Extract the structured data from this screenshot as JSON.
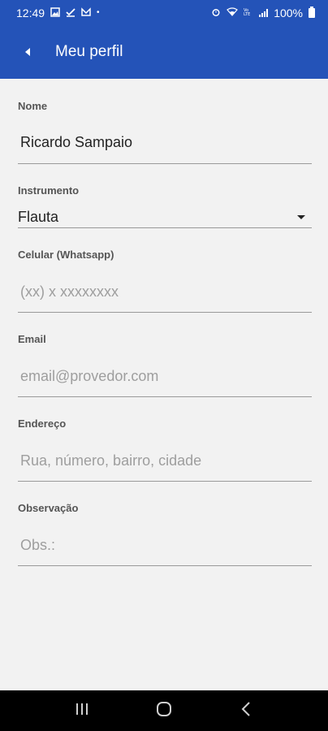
{
  "status_bar": {
    "time": "12:49",
    "battery_text": "100%",
    "icons_left": [
      "image-icon",
      "check-icon",
      "mail-icon",
      "dot-icon"
    ],
    "icons_right": [
      "alarm-icon",
      "wifi-icon",
      "volte-icon",
      "signal-icon",
      "battery-icon"
    ]
  },
  "app_bar": {
    "title": "Meu perfil",
    "back_icon": "back-arrow-icon",
    "color": "#2453b8"
  },
  "form": {
    "nome": {
      "label": "Nome",
      "value": "Ricardo Sampaio"
    },
    "instrumento": {
      "label": "Instrumento",
      "value": "Flauta"
    },
    "celular": {
      "label": "Celular (Whatsapp)",
      "placeholder": "(xx) x xxxxxxxx"
    },
    "email": {
      "label": "Email",
      "placeholder": "email@provedor.com"
    },
    "endereco": {
      "label": "Endereço",
      "placeholder": "Rua, número, bairro, cidade"
    },
    "observacao": {
      "label": "Observação",
      "placeholder": "Obs.:"
    }
  },
  "nav_bar": {
    "buttons": [
      "recents-icon",
      "home-icon",
      "back-icon"
    ]
  }
}
